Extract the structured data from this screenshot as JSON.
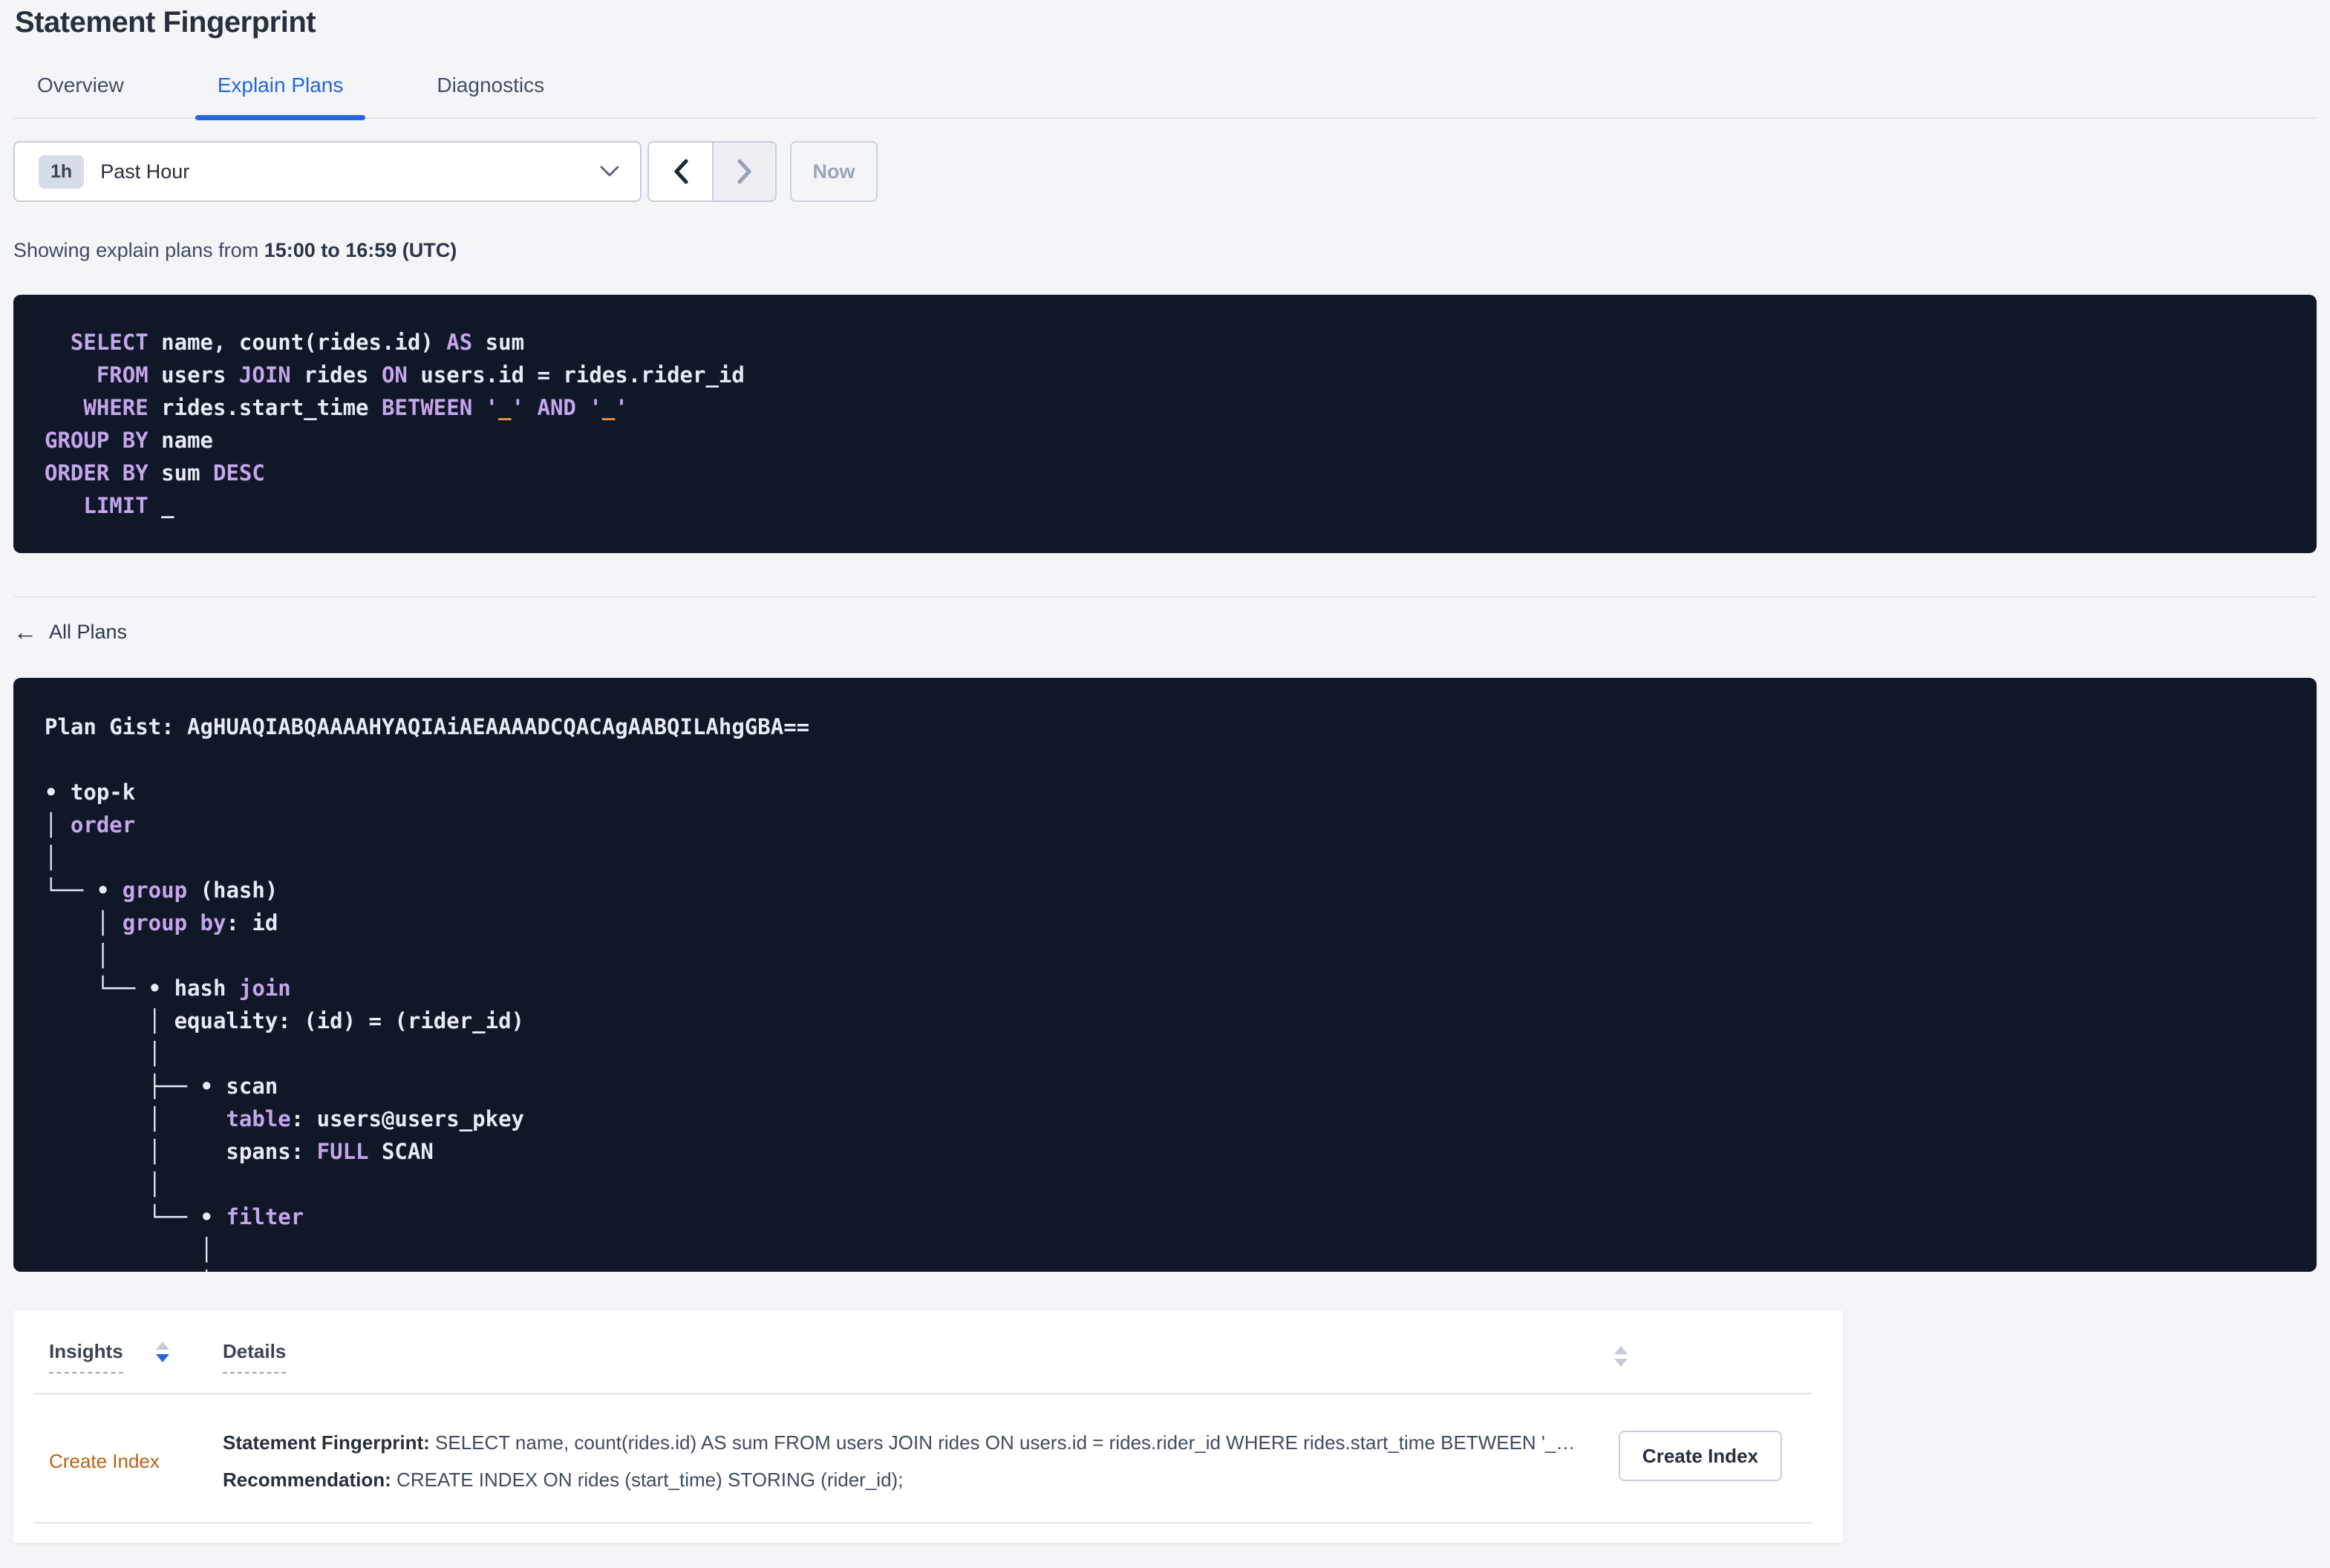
{
  "page": {
    "title": "Statement Fingerprint"
  },
  "tabs": [
    {
      "label": "Overview",
      "active": false
    },
    {
      "label": "Explain Plans",
      "active": true
    },
    {
      "label": "Diagnostics",
      "active": false
    }
  ],
  "time_controls": {
    "interval_badge": "1h",
    "selected_range": "Past Hour",
    "now_label": "Now"
  },
  "showing": {
    "prefix": "Showing explain plans from ",
    "range_bold": "15:00 to 16:59 (UTC)"
  },
  "sql_block": {
    "lines": [
      [
        {
          "c": "k",
          "t": "  SELECT"
        },
        {
          "c": "w",
          "t": " name, count(rides.id) "
        },
        {
          "c": "k",
          "t": "AS"
        },
        {
          "c": "w",
          "t": " sum"
        }
      ],
      [
        {
          "c": "k",
          "t": "    FROM"
        },
        {
          "c": "w",
          "t": " users "
        },
        {
          "c": "k",
          "t": "JOIN"
        },
        {
          "c": "w",
          "t": " rides "
        },
        {
          "c": "k",
          "t": "ON"
        },
        {
          "c": "w",
          "t": " users.id = rides.rider_id"
        }
      ],
      [
        {
          "c": "k",
          "t": "   WHERE"
        },
        {
          "c": "w",
          "t": " rides.start_time "
        },
        {
          "c": "k",
          "t": "BETWEEN"
        },
        {
          "c": "k",
          "t": " '"
        },
        {
          "c": "o",
          "t": "_"
        },
        {
          "c": "k",
          "t": "'"
        },
        {
          "c": "k",
          "t": " AND"
        },
        {
          "c": "k",
          "t": " '"
        },
        {
          "c": "o",
          "t": "_"
        },
        {
          "c": "k",
          "t": "'"
        }
      ],
      [
        {
          "c": "k",
          "t": "GROUP BY"
        },
        {
          "c": "w",
          "t": " name"
        }
      ],
      [
        {
          "c": "k",
          "t": "ORDER BY"
        },
        {
          "c": "w",
          "t": " sum "
        },
        {
          "c": "k",
          "t": "DESC"
        }
      ],
      [
        {
          "c": "k",
          "t": "   LIMIT"
        },
        {
          "c": "w",
          "t": " _"
        }
      ]
    ]
  },
  "all_plans": {
    "label": "All Plans",
    "arrow": "←"
  },
  "plan_block": {
    "gist": "Plan Gist: AgHUAQIABQAAAAHYAQIAiAEAAAADCQACAgAABQILAhgGBA==",
    "lines": [
      [
        {
          "c": "w",
          "t": "Plan Gist: AgHUAQIABQAAAAHYAQIAiAEAAAADCQACAgAABQILAhgGBA=="
        }
      ],
      [],
      [
        {
          "c": "w",
          "t": "• top-k"
        }
      ],
      [
        {
          "c": "w",
          "t": "│ "
        },
        {
          "c": "k",
          "t": "order"
        }
      ],
      [
        {
          "c": "w",
          "t": "│"
        }
      ],
      [
        {
          "c": "w",
          "t": "└── • "
        },
        {
          "c": "k",
          "t": "group"
        },
        {
          "c": "w",
          "t": " (hash)"
        }
      ],
      [
        {
          "c": "w",
          "t": "    │ "
        },
        {
          "c": "k",
          "t": "group by"
        },
        {
          "c": "w",
          "t": ": id"
        }
      ],
      [
        {
          "c": "w",
          "t": "    │"
        }
      ],
      [
        {
          "c": "w",
          "t": "    └── • hash "
        },
        {
          "c": "k",
          "t": "join"
        }
      ],
      [
        {
          "c": "w",
          "t": "        │ equality: (id) = (rider_id)"
        }
      ],
      [
        {
          "c": "w",
          "t": "        │"
        }
      ],
      [
        {
          "c": "w",
          "t": "        ├── • scan"
        }
      ],
      [
        {
          "c": "w",
          "t": "        │     "
        },
        {
          "c": "k",
          "t": "table"
        },
        {
          "c": "w",
          "t": ": users@users_pkey"
        }
      ],
      [
        {
          "c": "w",
          "t": "        │     spans: "
        },
        {
          "c": "k",
          "t": "FULL"
        },
        {
          "c": "w",
          "t": " SCAN"
        }
      ],
      [
        {
          "c": "w",
          "t": "        │"
        }
      ],
      [
        {
          "c": "w",
          "t": "        └── • "
        },
        {
          "c": "k",
          "t": "filter"
        }
      ],
      [
        {
          "c": "w",
          "t": "            │"
        }
      ],
      [
        {
          "c": "w",
          "t": "            │"
        }
      ]
    ]
  },
  "insights_table": {
    "headers": [
      {
        "label": "Insights"
      },
      {
        "label": "Details"
      }
    ],
    "row": {
      "insight": "Create Index",
      "statement_label": "Statement Fingerprint:",
      "statement_text": "SELECT name, count(rides.id) AS sum FROM users JOIN rides ON users.id = rides.rider_id WHERE rides.start_time BETWEEN '_…",
      "recommendation_label": "Recommendation:",
      "recommendation_text": "CREATE INDEX ON rides (start_time) STORING (rider_id);",
      "action_label": "Create Index"
    }
  },
  "colors": {
    "accent_blue": "#2566dd",
    "code_background": "#101828",
    "code_keyword": "#c5a5ec",
    "code_text": "#e8ebf3",
    "code_literal_orange": "#ec9b40",
    "insight_link_orange": "#bf6110"
  }
}
